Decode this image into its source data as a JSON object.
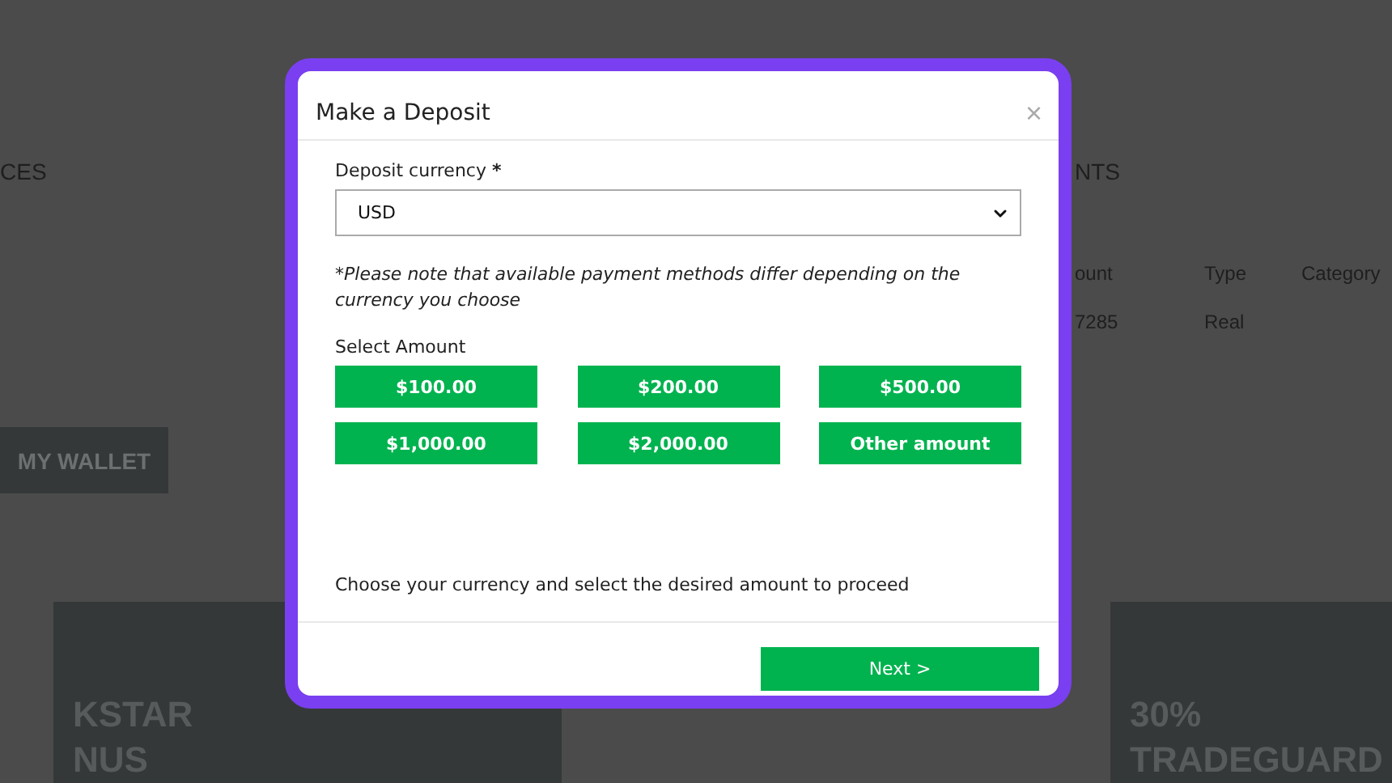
{
  "background": {
    "left_heading": "CES",
    "right_heading": "NTS",
    "table": {
      "columns": [
        "ount",
        "Type",
        "Category"
      ],
      "rows": [
        [
          "7285",
          "Real",
          ""
        ]
      ]
    },
    "wallet_button": "MY WALLET",
    "cards": [
      {
        "lines": [
          "KSTAR",
          "NUS"
        ]
      },
      {
        "lines": [
          "30%",
          "TRADEGUARD"
        ]
      }
    ]
  },
  "dialog": {
    "title": "Make a Deposit",
    "close": "×",
    "currency_label": "Deposit currency",
    "required_mark": "*",
    "currency_value": "USD",
    "note": "*Please note that available payment methods differ depending on the currency you choose",
    "amount_label": "Select Amount",
    "amounts": [
      "$100.00",
      "$200.00",
      "$500.00",
      "$1,000.00",
      "$2,000.00",
      "Other amount"
    ],
    "hint": "Choose your currency and select the desired amount to proceed",
    "next_button": "Next >"
  }
}
